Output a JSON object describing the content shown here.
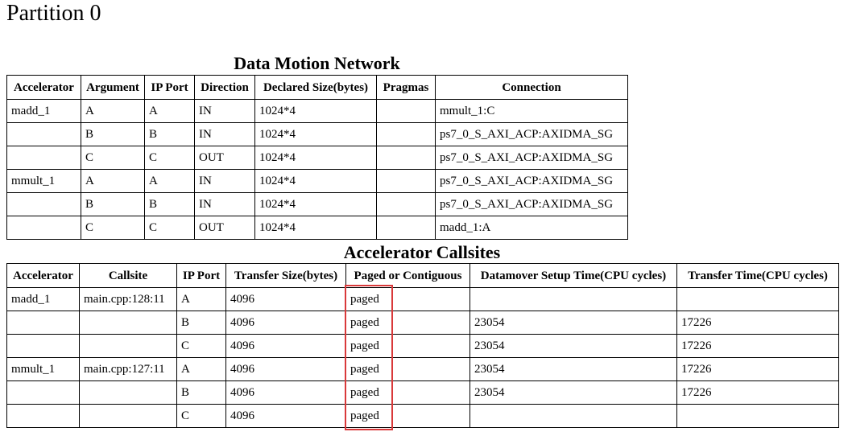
{
  "page": {
    "title": "Partition 0"
  },
  "data_motion_network": {
    "title": "Data Motion Network",
    "columns": [
      "Accelerator",
      "Argument",
      "IP Port",
      "Direction",
      "Declared Size(bytes)",
      "Pragmas",
      "Connection"
    ],
    "rows": [
      {
        "accelerator": "madd_1",
        "argument": "A",
        "ip_port": "A",
        "direction": "IN",
        "declared_size": "1024*4",
        "pragmas": "",
        "connection": "mmult_1:C"
      },
      {
        "accelerator": "",
        "argument": "B",
        "ip_port": "B",
        "direction": "IN",
        "declared_size": "1024*4",
        "pragmas": "",
        "connection": "ps7_0_S_AXI_ACP:AXIDMA_SG"
      },
      {
        "accelerator": "",
        "argument": "C",
        "ip_port": "C",
        "direction": "OUT",
        "declared_size": "1024*4",
        "pragmas": "",
        "connection": "ps7_0_S_AXI_ACP:AXIDMA_SG"
      },
      {
        "accelerator": "mmult_1",
        "argument": "A",
        "ip_port": "A",
        "direction": "IN",
        "declared_size": "1024*4",
        "pragmas": "",
        "connection": "ps7_0_S_AXI_ACP:AXIDMA_SG"
      },
      {
        "accelerator": "",
        "argument": "B",
        "ip_port": "B",
        "direction": "IN",
        "declared_size": "1024*4",
        "pragmas": "",
        "connection": "ps7_0_S_AXI_ACP:AXIDMA_SG"
      },
      {
        "accelerator": "",
        "argument": "C",
        "ip_port": "C",
        "direction": "OUT",
        "declared_size": "1024*4",
        "pragmas": "",
        "connection": "madd_1:A"
      }
    ]
  },
  "accelerator_callsites": {
    "title": "Accelerator Callsites",
    "columns": [
      "Accelerator",
      "Callsite",
      "IP Port",
      "Transfer Size(bytes)",
      "Paged or Contiguous",
      "Datamover Setup Time(CPU cycles)",
      "Transfer Time(CPU cycles)"
    ],
    "rows": [
      {
        "accelerator": "madd_1",
        "callsite": "main.cpp:128:11",
        "ip_port": "A",
        "transfer_size": "4096",
        "paged_or_contiguous": "paged",
        "setup_time": "",
        "transfer_time": ""
      },
      {
        "accelerator": "",
        "callsite": "",
        "ip_port": "B",
        "transfer_size": "4096",
        "paged_or_contiguous": "paged",
        "setup_time": "23054",
        "transfer_time": "17226"
      },
      {
        "accelerator": "",
        "callsite": "",
        "ip_port": "C",
        "transfer_size": "4096",
        "paged_or_contiguous": "paged",
        "setup_time": "23054",
        "transfer_time": "17226"
      },
      {
        "accelerator": "mmult_1",
        "callsite": "main.cpp:127:11",
        "ip_port": "A",
        "transfer_size": "4096",
        "paged_or_contiguous": "paged",
        "setup_time": "23054",
        "transfer_time": "17226"
      },
      {
        "accelerator": "",
        "callsite": "",
        "ip_port": "B",
        "transfer_size": "4096",
        "paged_or_contiguous": "paged",
        "setup_time": "23054",
        "transfer_time": "17226"
      },
      {
        "accelerator": "",
        "callsite": "",
        "ip_port": "C",
        "transfer_size": "4096",
        "paged_or_contiguous": "paged",
        "setup_time": "",
        "transfer_time": ""
      }
    ]
  },
  "highlight": {
    "color": "#d9393a",
    "target": "Paged or Contiguous values"
  }
}
